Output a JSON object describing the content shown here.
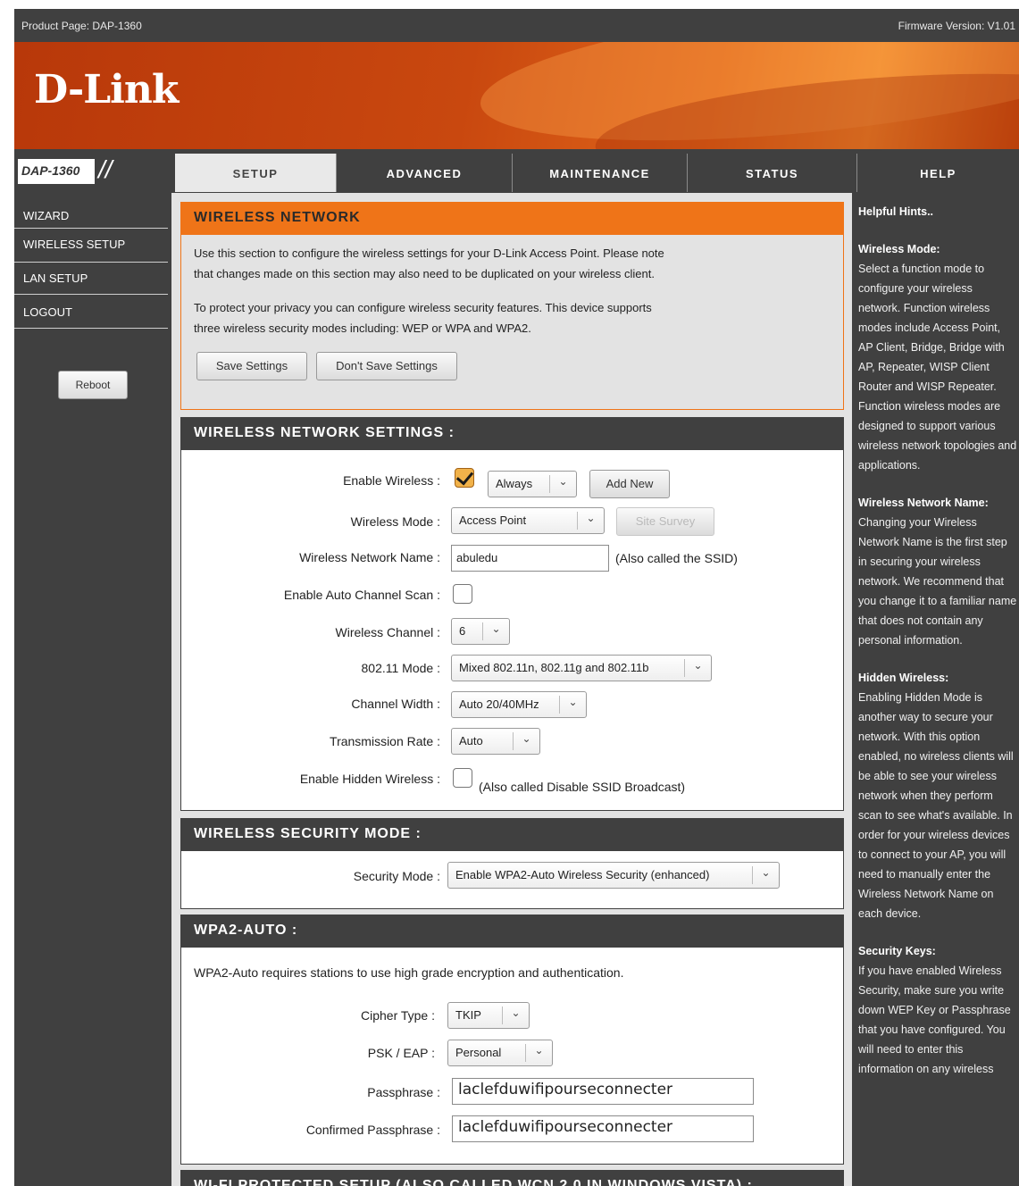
{
  "topbar": {
    "product": "Product Page: DAP-1360",
    "firmware": "Firmware Version: V1.01"
  },
  "brand": {
    "logo": "D-Link",
    "model": "DAP-1360",
    "slashes": "//"
  },
  "tabs": [
    {
      "label": "SETUP",
      "active": true
    },
    {
      "label": "ADVANCED",
      "active": false
    },
    {
      "label": "MAINTENANCE",
      "active": false
    },
    {
      "label": "STATUS",
      "active": false
    },
    {
      "label": "HELP",
      "active": false
    }
  ],
  "sidebar": {
    "items": [
      {
        "label": "WIZARD"
      },
      {
        "label": "WIRELESS SETUP"
      },
      {
        "label": "LAN SETUP"
      },
      {
        "label": "LOGOUT"
      }
    ],
    "reboot": "Reboot"
  },
  "intro": {
    "title": "WIRELESS NETWORK",
    "p1a": "Use this section to configure the wireless settings for your D-Link Access Point. Please note",
    "p1b": "that changes made on this section may also need to be duplicated on your wireless client.",
    "p2a": "To protect your privacy you can configure wireless security features. This device supports",
    "p2b": "three wireless security modes including: WEP or WPA and WPA2.",
    "save": "Save Settings",
    "dont_save": "Don't Save Settings"
  },
  "settings": {
    "title": "WIRELESS NETWORK SETTINGS :",
    "enable_wireless_label": "Enable Wireless :",
    "enable_wireless_checked": true,
    "schedule": "Always",
    "add_new": "Add New",
    "mode_label": "Wireless Mode :",
    "mode": "Access Point",
    "site_survey": "Site Survey",
    "ssid_label": "Wireless Network Name :",
    "ssid": "abuledu",
    "ssid_note": "(Also called the SSID)",
    "auto_channel_label": "Enable Auto Channel Scan :",
    "auto_channel_checked": false,
    "channel_label": "Wireless Channel :",
    "channel": "6",
    "dot11_label": "802.11 Mode :",
    "dot11": "Mixed 802.11n, 802.11g and 802.11b",
    "width_label": "Channel Width :",
    "width": "Auto 20/40MHz",
    "rate_label": "Transmission Rate :",
    "rate": "Auto",
    "hidden_label": "Enable Hidden Wireless :",
    "hidden_checked": false,
    "hidden_note": "(Also called Disable SSID Broadcast)"
  },
  "security": {
    "title": "WIRELESS SECURITY MODE :",
    "mode_label": "Security Mode :",
    "mode": "Enable WPA2-Auto Wireless Security (enhanced)"
  },
  "wpa": {
    "title": "WPA2-AUTO :",
    "desc": "WPA2-Auto requires stations to use high grade encryption and authentication.",
    "cipher_label": "Cipher Type :",
    "cipher": "TKIP",
    "psk_label": "PSK / EAP :",
    "psk": "Personal",
    "pass_label": "Passphrase :",
    "pass": "laclefduwifipourseconnecter",
    "confirm_label": "Confirmed Passphrase :",
    "confirm": "laclefduwifipourseconnecter"
  },
  "wps": {
    "title": "WI-FI PROTECTED SETUP (ALSO CALLED WCN 2.0 IN WINDOWS VISTA) :"
  },
  "hints": {
    "title": "Helpful Hints..",
    "mode_title": "Wireless Mode:",
    "mode_text": "Select a function mode to configure your wireless network. Function wireless modes include Access Point, AP Client, Bridge, Bridge with AP, Repeater, WISP Client Router and WISP Repeater. Function wireless modes are designed to support various wireless network topologies and applications.",
    "name_title": "Wireless Network Name:",
    "name_text": "Changing your Wireless Network Name is the first step in securing your wireless network. We recommend that you change it to a familiar name that does not contain any personal information.",
    "hidden_title": "Hidden Wireless:",
    "hidden_text": "Enabling Hidden Mode is another way to secure your network. With this option enabled, no wireless clients will be able to see your wireless network when they perform scan to see what's available. In order for your wireless devices to connect to your AP, you will need to manually enter the Wireless Network Name on each device.",
    "keys_title": "Security Keys:",
    "keys_text": "If you have enabled Wireless Security, make sure you write down WEP Key or Passphrase that you have configured. You will need to enter this information on any wireless"
  },
  "icons": {
    "dropdown": "chevron-down-icon",
    "check": "checkmark-icon"
  },
  "colors": {
    "accent": "#ef7418",
    "dark": "#404040",
    "panel": "#e3e3e3"
  }
}
